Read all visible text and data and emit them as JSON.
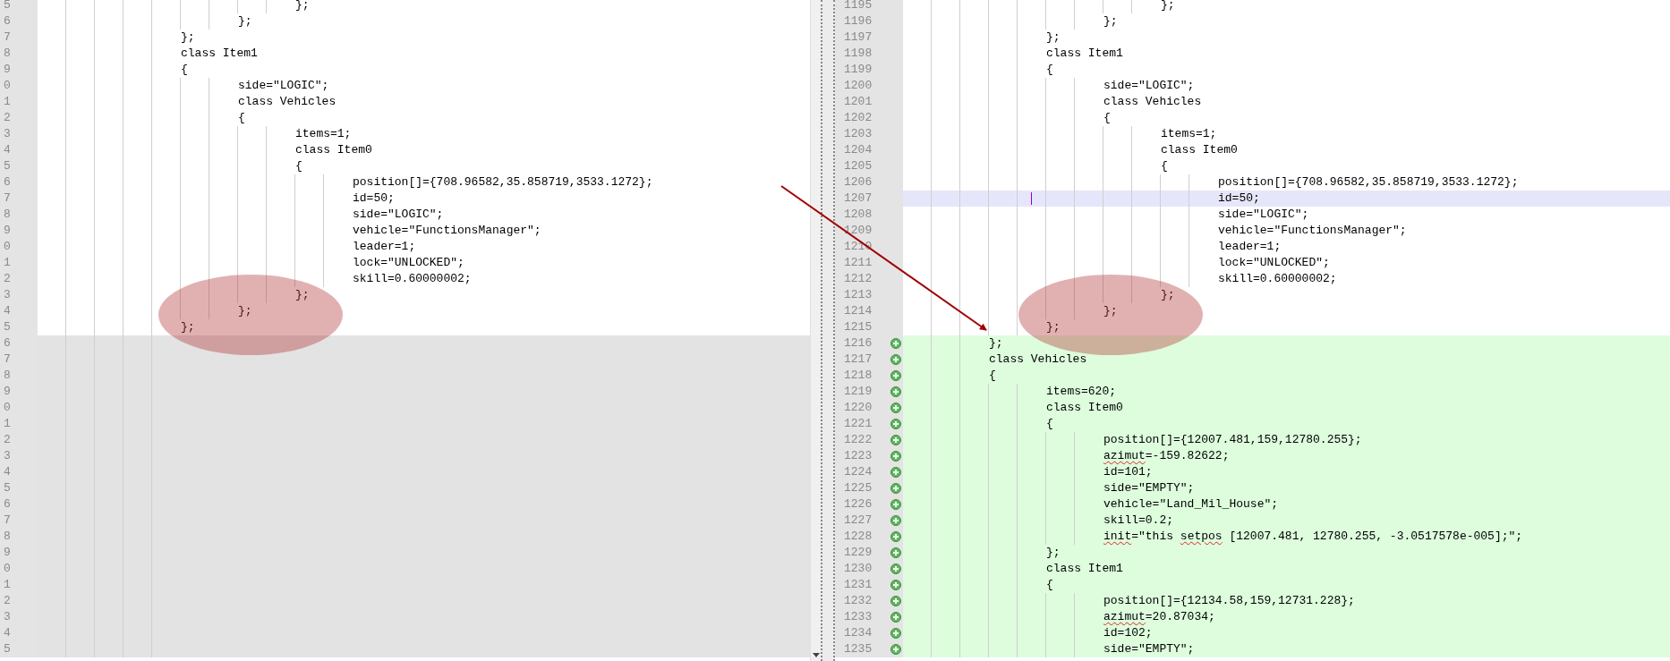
{
  "left_pane": {
    "lines": [
      {
        "number": "5",
        "kind": "same",
        "text": "\t\t\t\t};"
      },
      {
        "number": "6",
        "kind": "same",
        "text": "\t\t\t};"
      },
      {
        "number": "7",
        "kind": "same",
        "text": "\t\t};"
      },
      {
        "number": "8",
        "kind": "same",
        "text": "\t\tclass Item1"
      },
      {
        "number": "9",
        "kind": "same",
        "text": "\t\t{"
      },
      {
        "number": "0",
        "kind": "same",
        "text": "\t\t\tside=\"LOGIC\";"
      },
      {
        "number": "1",
        "kind": "same",
        "text": "\t\t\tclass Vehicles"
      },
      {
        "number": "2",
        "kind": "same",
        "text": "\t\t\t{"
      },
      {
        "number": "3",
        "kind": "same",
        "text": "\t\t\t\titems=1;"
      },
      {
        "number": "4",
        "kind": "same",
        "text": "\t\t\t\tclass Item0"
      },
      {
        "number": "5",
        "kind": "same",
        "text": "\t\t\t\t{"
      },
      {
        "number": "6",
        "kind": "same",
        "text": "\t\t\t\t\tposition[]={708.96582,35.858719,3533.1272};"
      },
      {
        "number": "7",
        "kind": "same",
        "text": "\t\t\t\t\tid=50;"
      },
      {
        "number": "8",
        "kind": "same",
        "text": "\t\t\t\t\tside=\"LOGIC\";"
      },
      {
        "number": "9",
        "kind": "same",
        "text": "\t\t\t\t\tvehicle=\"FunctionsManager\";"
      },
      {
        "number": "0",
        "kind": "same",
        "text": "\t\t\t\t\tleader=1;"
      },
      {
        "number": "1",
        "kind": "same",
        "text": "\t\t\t\t\tlock=\"UNLOCKED\";"
      },
      {
        "number": "2",
        "kind": "same",
        "text": "\t\t\t\t\tskill=0.60000002;"
      },
      {
        "number": "3",
        "kind": "same",
        "text": "\t\t\t\t};"
      },
      {
        "number": "4",
        "kind": "same",
        "text": "\t\t\t};"
      },
      {
        "number": "5",
        "kind": "same",
        "text": "\t\t};"
      },
      {
        "number": "6",
        "kind": "missing"
      },
      {
        "number": "7",
        "kind": "missing"
      },
      {
        "number": "8",
        "kind": "missing"
      },
      {
        "number": "9",
        "kind": "missing"
      },
      {
        "number": "0",
        "kind": "missing"
      },
      {
        "number": "1",
        "kind": "missing"
      },
      {
        "number": "2",
        "kind": "missing"
      },
      {
        "number": "3",
        "kind": "missing"
      },
      {
        "number": "4",
        "kind": "missing"
      },
      {
        "number": "5",
        "kind": "missing"
      },
      {
        "number": "6",
        "kind": "missing"
      },
      {
        "number": "7",
        "kind": "missing"
      },
      {
        "number": "8",
        "kind": "missing"
      },
      {
        "number": "9",
        "kind": "missing"
      },
      {
        "number": "0",
        "kind": "missing"
      },
      {
        "number": "1",
        "kind": "missing"
      },
      {
        "number": "2",
        "kind": "missing"
      },
      {
        "number": "3",
        "kind": "missing"
      },
      {
        "number": "4",
        "kind": "missing"
      },
      {
        "number": "5",
        "kind": "missing"
      }
    ]
  },
  "right_pane": {
    "lines": [
      {
        "number": "1195",
        "kind": "same",
        "current": false,
        "text": "\t\t\t\t};"
      },
      {
        "number": "1196",
        "kind": "same",
        "current": false,
        "text": "\t\t\t};"
      },
      {
        "number": "1197",
        "kind": "same",
        "current": false,
        "text": "\t\t};"
      },
      {
        "number": "1198",
        "kind": "same",
        "current": false,
        "text": "\t\tclass Item1"
      },
      {
        "number": "1199",
        "kind": "same",
        "current": false,
        "text": "\t\t{"
      },
      {
        "number": "1200",
        "kind": "same",
        "current": false,
        "text": "\t\t\tside=\"LOGIC\";"
      },
      {
        "number": "1201",
        "kind": "same",
        "current": false,
        "text": "\t\t\tclass Vehicles"
      },
      {
        "number": "1202",
        "kind": "same",
        "current": false,
        "text": "\t\t\t{"
      },
      {
        "number": "1203",
        "kind": "same",
        "current": false,
        "text": "\t\t\t\titems=1;"
      },
      {
        "number": "1204",
        "kind": "same",
        "current": false,
        "text": "\t\t\t\tclass Item0"
      },
      {
        "number": "1205",
        "kind": "same",
        "current": false,
        "text": "\t\t\t\t{"
      },
      {
        "number": "1206",
        "kind": "same",
        "current": false,
        "text": "\t\t\t\t\tposition[]={708.96582,35.858719,3533.1272};"
      },
      {
        "number": "1207",
        "kind": "same",
        "current": true,
        "text": "\t\t\t\t\tid=50;"
      },
      {
        "number": "1208",
        "kind": "same",
        "current": false,
        "text": "\t\t\t\t\tside=\"LOGIC\";"
      },
      {
        "number": "1209",
        "kind": "same",
        "current": false,
        "text": "\t\t\t\t\tvehicle=\"FunctionsManager\";"
      },
      {
        "number": "1210",
        "kind": "same",
        "current": false,
        "text": "\t\t\t\t\tleader=1;"
      },
      {
        "number": "1211",
        "kind": "same",
        "current": false,
        "text": "\t\t\t\t\tlock=\"UNLOCKED\";"
      },
      {
        "number": "1212",
        "kind": "same",
        "current": false,
        "text": "\t\t\t\t\tskill=0.60000002;"
      },
      {
        "number": "1213",
        "kind": "same",
        "current": false,
        "text": "\t\t\t\t};"
      },
      {
        "number": "1214",
        "kind": "same",
        "current": false,
        "text": "\t\t\t};"
      },
      {
        "number": "1215",
        "kind": "same",
        "current": false,
        "text": "\t\t};"
      },
      {
        "number": "1216",
        "kind": "added",
        "current": false,
        "text": "\t};"
      },
      {
        "number": "1217",
        "kind": "added",
        "current": false,
        "text": "\tclass Vehicles"
      },
      {
        "number": "1218",
        "kind": "added",
        "current": false,
        "text": "\t{"
      },
      {
        "number": "1219",
        "kind": "added",
        "current": false,
        "text": "\t\titems=620;"
      },
      {
        "number": "1220",
        "kind": "added",
        "current": false,
        "text": "\t\tclass Item0"
      },
      {
        "number": "1221",
        "kind": "added",
        "current": false,
        "text": "\t\t{"
      },
      {
        "number": "1222",
        "kind": "added",
        "current": false,
        "text": "\t\t\tposition[]={12007.481,159,12780.255};"
      },
      {
        "number": "1223",
        "kind": "added",
        "current": false,
        "parts": [
          {
            "text": "\t\t\tazimut",
            "misspelled": true
          },
          {
            "text": "=-159.82622;",
            "misspelled": false
          }
        ]
      },
      {
        "number": "1224",
        "kind": "added",
        "current": false,
        "text": "\t\t\tid=101;"
      },
      {
        "number": "1225",
        "kind": "added",
        "current": false,
        "text": "\t\t\tside=\"EMPTY\";"
      },
      {
        "number": "1226",
        "kind": "added",
        "current": false,
        "text": "\t\t\tvehicle=\"Land_Mil_House\";"
      },
      {
        "number": "1227",
        "kind": "added",
        "current": false,
        "text": "\t\t\tskill=0.2;"
      },
      {
        "number": "1228",
        "kind": "added",
        "current": false,
        "parts": [
          {
            "text": "\t\t\tinit",
            "misspelled": true
          },
          {
            "text": "=\"this ",
            "misspelled": false
          },
          {
            "text": "setpos",
            "misspelled": true
          },
          {
            "text": " [12007.481, 12780.255, -3.0517578e-005];\";",
            "misspelled": false
          }
        ]
      },
      {
        "number": "1229",
        "kind": "added",
        "current": false,
        "text": "\t\t};"
      },
      {
        "number": "1230",
        "kind": "added",
        "current": false,
        "text": "\t\tclass Item1"
      },
      {
        "number": "1231",
        "kind": "added",
        "current": false,
        "text": "\t\t{"
      },
      {
        "number": "1232",
        "kind": "added",
        "current": false,
        "text": "\t\t\tposition[]={12134.58,159,12731.228};"
      },
      {
        "number": "1233",
        "kind": "added",
        "current": false,
        "parts": [
          {
            "text": "\t\t\tazimut",
            "misspelled": true
          },
          {
            "text": "=20.87034;",
            "misspelled": false
          }
        ]
      },
      {
        "number": "1234",
        "kind": "added",
        "current": false,
        "text": "\t\t\tid=102;"
      },
      {
        "number": "1235",
        "kind": "added",
        "current": false,
        "text": "\t\t\tside=\"EMPTY\";"
      }
    ]
  }
}
